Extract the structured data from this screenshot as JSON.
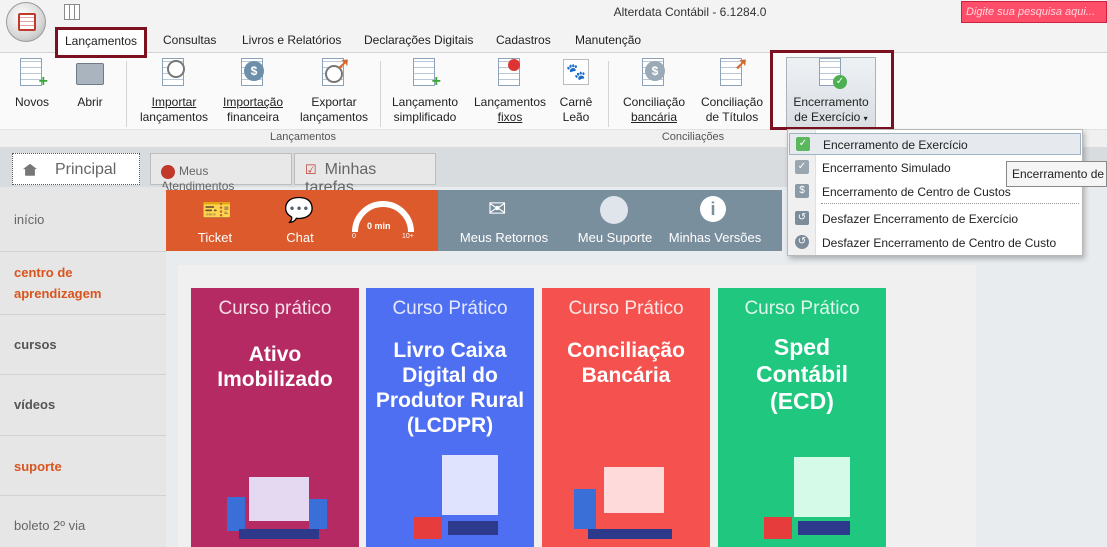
{
  "app": {
    "title": "Alterdata Contábil - 6.1284.0",
    "search_placeholder": "Digite sua pesquisa aqui..."
  },
  "menu": {
    "tabs": [
      "Lançamentos",
      "Consultas",
      "Livros e Relatórios",
      "Declarações Digitais",
      "Cadastros",
      "Manutenção"
    ]
  },
  "ribbon": {
    "buttons": [
      {
        "l1": "Novos",
        "l2": ""
      },
      {
        "l1": "Abrir",
        "l2": ""
      },
      {
        "l1": "Importar",
        "l2": "lançamentos"
      },
      {
        "l1": "Importação",
        "l2": "financeira"
      },
      {
        "l1": "Exportar",
        "l2": "lançamentos"
      },
      {
        "l1": "Lançamento",
        "l2": "simplificado"
      },
      {
        "l1": "Lançamentos",
        "l2": "fixos"
      },
      {
        "l1": "Carnê",
        "l2": "Leão"
      },
      {
        "l1": "Conciliação",
        "l2": "bancária"
      },
      {
        "l1": "Conciliação",
        "l2": "de Títulos"
      },
      {
        "l1": "Encerramento",
        "l2": "de Exercício"
      }
    ],
    "groups": {
      "lancamentos": "Lançamentos",
      "conciliacoes": "Conciliações"
    }
  },
  "content_tabs": [
    "Principal",
    "Meus Atendimentos",
    "Minhas tarefas"
  ],
  "leftnav": {
    "inicio": "início",
    "centro_l1": "centro de",
    "centro_l2": "aprendizagem",
    "cursos": "cursos",
    "videos": "vídeos",
    "suporte": "suporte",
    "boleto": "boleto 2º via"
  },
  "support_bar": {
    "ticket": "Ticket",
    "chat": "Chat",
    "gauge_value": "0 min",
    "gauge_min": "0",
    "gauge_max": "10+",
    "retornos": "Meus Retornos",
    "suporte": "Meu Suporte",
    "versoes": "Minhas Versões"
  },
  "cards": [
    {
      "kicker": "Curso prático",
      "l1": "Ativo",
      "l2": "Imobilizado",
      "l3": "",
      "l4": "",
      "color": "#b62a63"
    },
    {
      "kicker": "Curso Prático",
      "l1": "Livro Caixa",
      "l2": "Digital do",
      "l3": "Produtor Rural",
      "l4": "(LCDPR)",
      "color": "#4f6ff2"
    },
    {
      "kicker": "Curso Prático",
      "l1": "Conciliação",
      "l2": "Bancária",
      "l3": "",
      "l4": "",
      "color": "#f5524f"
    },
    {
      "kicker": "Curso Prático",
      "l1": "Sped",
      "l2": "Contábil",
      "l3": "(ECD)",
      "l4": "",
      "color": "#1fc77f"
    }
  ],
  "dropdown": {
    "items": [
      "Encerramento de Exercício",
      "Encerramento Simulado",
      "Encerramento de Centro de Custos",
      "Desfazer Encerramento de Exercício",
      "Desfazer Encerramento de Centro de Custo"
    ]
  },
  "tooltip": "Encerramento de E"
}
